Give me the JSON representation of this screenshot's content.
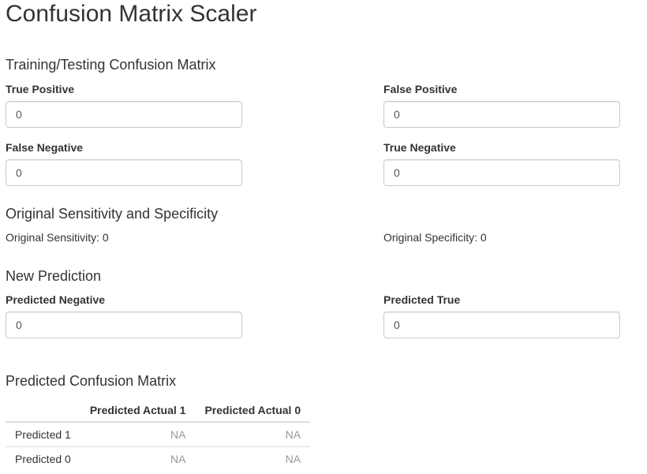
{
  "page": {
    "title": "Confusion Matrix Scaler"
  },
  "training": {
    "section_title": "Training/Testing Confusion Matrix",
    "true_positive": {
      "label": "True Positive",
      "value": "0"
    },
    "false_positive": {
      "label": "False Positive",
      "value": "0"
    },
    "false_negative": {
      "label": "False Negative",
      "value": "0"
    },
    "true_negative": {
      "label": "True Negative",
      "value": "0"
    }
  },
  "original": {
    "section_title": "Original Sensitivity and Specificity",
    "sensitivity_text": "Original Sensitivity: 0",
    "specificity_text": "Original Specificity: 0"
  },
  "new_prediction": {
    "section_title": "New Prediction",
    "predicted_negative": {
      "label": "Predicted Negative",
      "value": "0"
    },
    "predicted_true": {
      "label": "Predicted True",
      "value": "0"
    }
  },
  "predicted_matrix": {
    "section_title": "Predicted Confusion Matrix",
    "columns": [
      "",
      "Predicted Actual 1",
      "Predicted Actual 0"
    ],
    "rows": [
      {
        "label": "Predicted 1",
        "cells": [
          "NA",
          "NA"
        ]
      },
      {
        "label": "Predicted 0",
        "cells": [
          "NA",
          "NA"
        ]
      }
    ]
  }
}
